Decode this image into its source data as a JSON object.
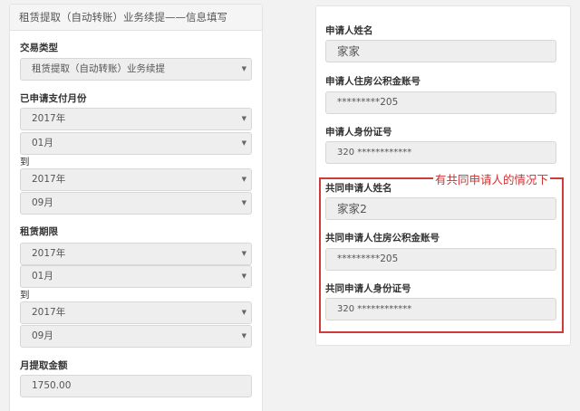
{
  "left": {
    "title": "租赁提取（自动转账）业务续提——信息填写",
    "transaction_type": {
      "label": "交易类型",
      "value": "租赁提取（自动转账）业务续提"
    },
    "paid_month": {
      "label": "已申请支付月份",
      "from_year": "2017年",
      "from_month": "01月",
      "to": "到",
      "to_year": "2017年",
      "to_month": "09月"
    },
    "lease_term": {
      "label": "租赁期限",
      "from_year": "2017年",
      "from_month": "01月",
      "to": "到",
      "to_year": "2017年",
      "to_month": "09月"
    },
    "monthly_amount": {
      "label": "月提取金额",
      "value": "1750.00"
    }
  },
  "right": {
    "applicant_name": {
      "label": "申请人姓名",
      "value": "家家"
    },
    "applicant_fund_account": {
      "label": "申请人住房公积金账号",
      "value": "*********205"
    },
    "applicant_id": {
      "label": "申请人身份证号",
      "value": "320 ************"
    },
    "co_applicant_name": {
      "label": "共同申请人姓名",
      "value": "家家2"
    },
    "co_applicant_fund_account": {
      "label": "共同申请人住房公积金账号",
      "value": "*********205"
    },
    "co_applicant_id": {
      "label": "共同申请人身份证号",
      "value": "320 ************"
    }
  },
  "annotation": {
    "text": "有共同申请人的情况下",
    "color": "#d03030"
  },
  "icons": {
    "select_caret": "▼"
  }
}
